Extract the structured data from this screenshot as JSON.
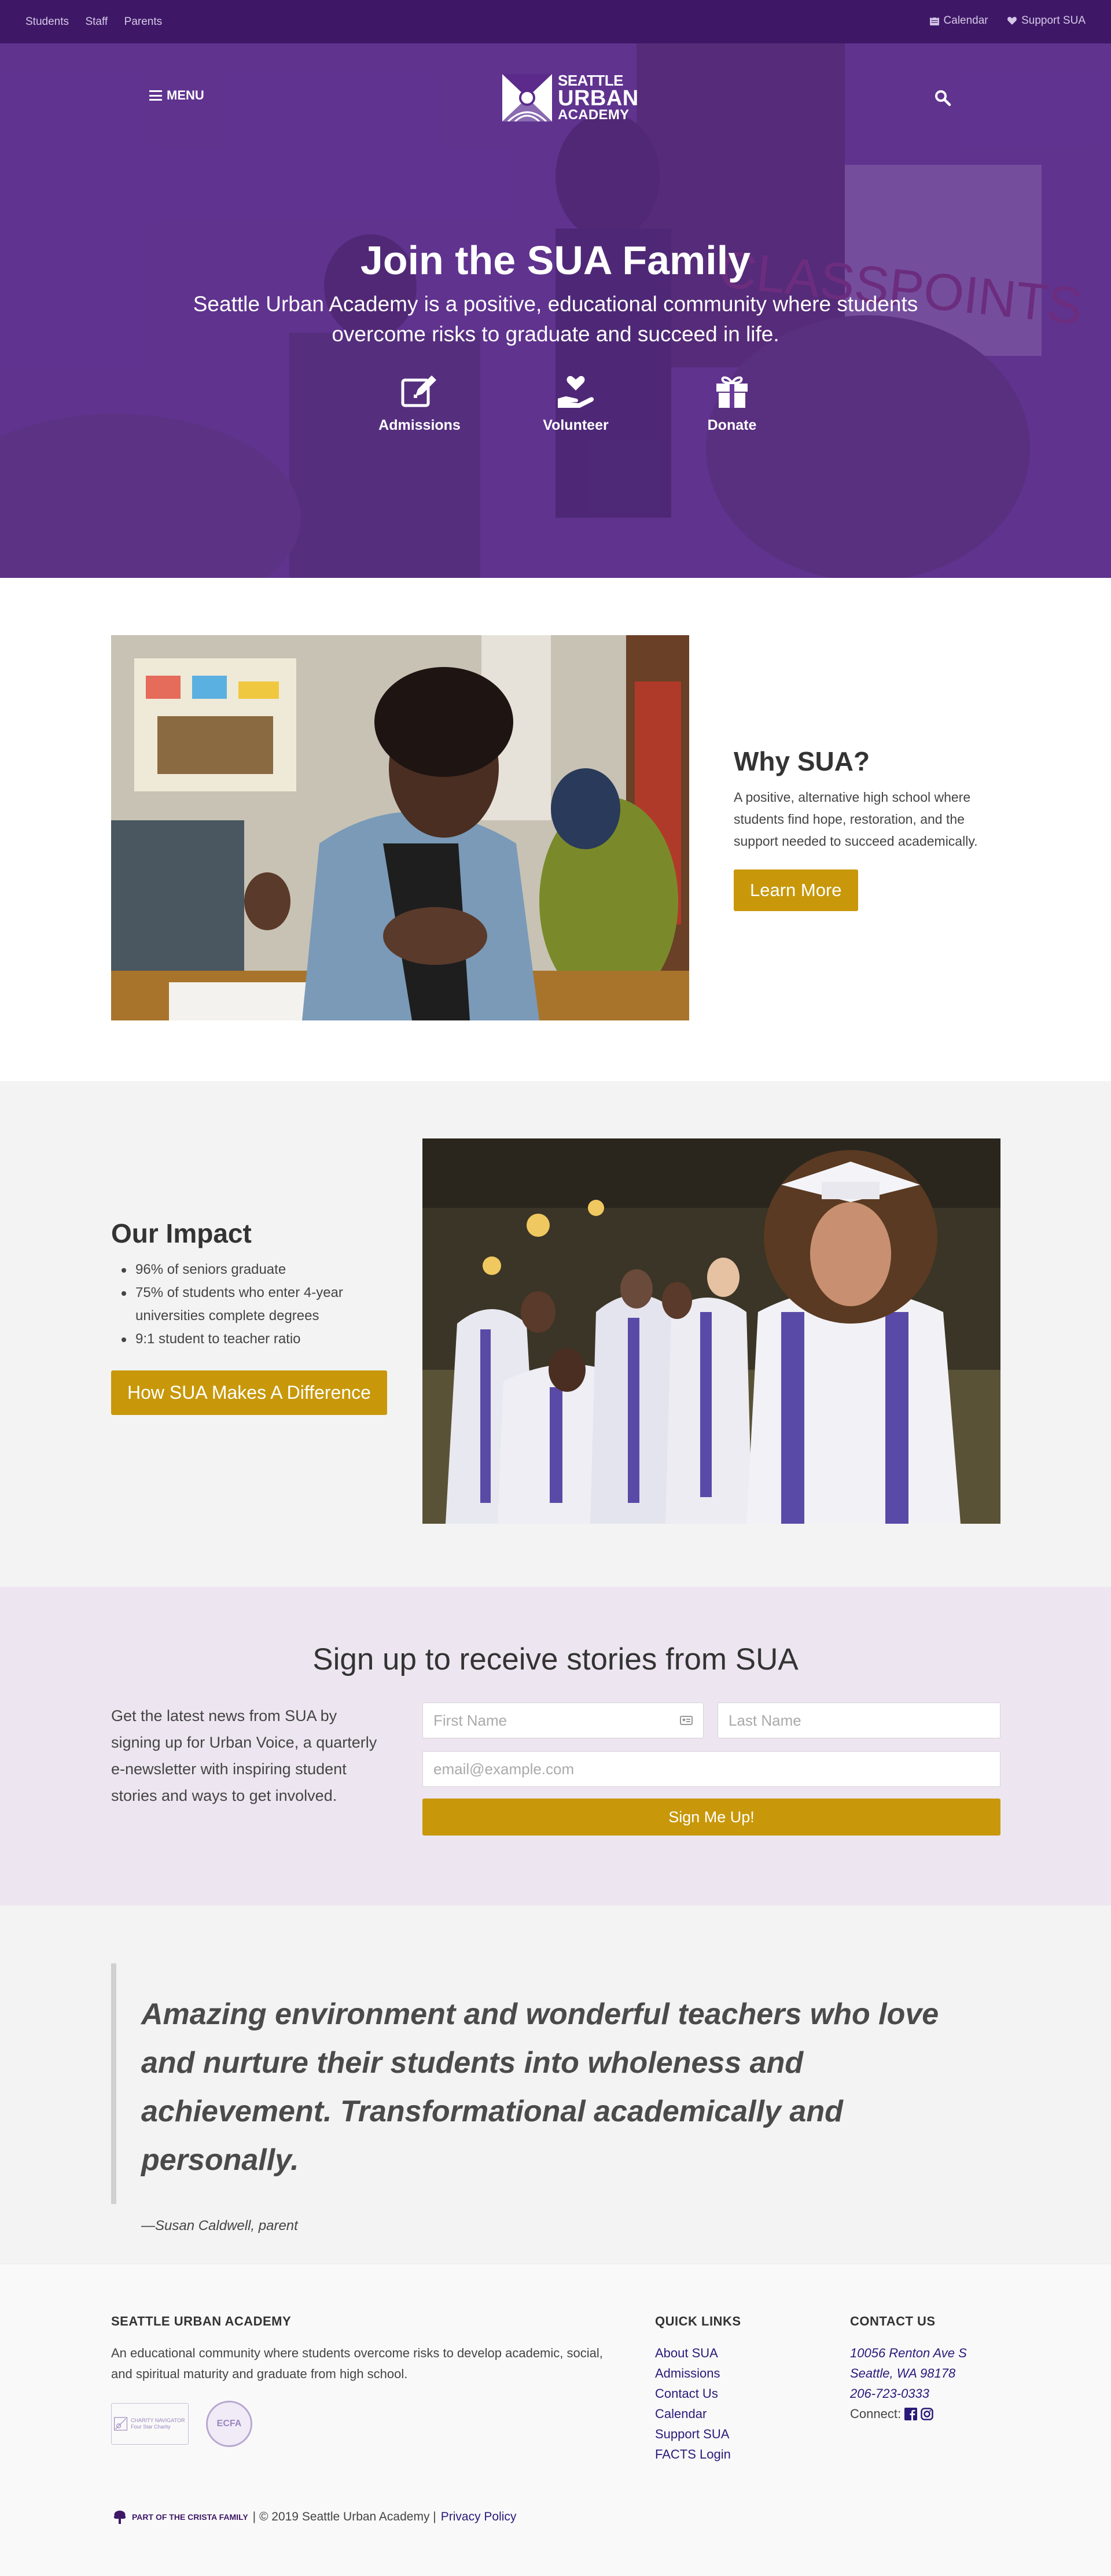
{
  "topbar": {
    "left_links": [
      "Students",
      "Staff",
      "Parents"
    ],
    "calendar": "Calendar",
    "support": "Support SUA"
  },
  "header": {
    "menu_label": "MENU",
    "logo": {
      "line1": "SEATTLE",
      "line2": "URBAN",
      "line3": "ACADEMY"
    }
  },
  "hero": {
    "title": "Join the SUA Family",
    "tagline": "Seattle Urban Academy is a positive, educational community where students overcome risks to graduate and succeed in life.",
    "actions": [
      {
        "label": "Admissions",
        "icon": "edit-icon"
      },
      {
        "label": "Volunteer",
        "icon": "hand-heart-icon"
      },
      {
        "label": "Donate",
        "icon": "gift-icon"
      }
    ],
    "overlay_color": "#5b2a8a"
  },
  "why": {
    "title": "Why SUA?",
    "body": "A positive, alternative high school where students find hope, restoration, and the support needed to succeed academically.",
    "button": "Learn More"
  },
  "impact": {
    "title": "Our Impact",
    "items": [
      "96% of seniors graduate",
      "75% of students who enter 4-year universities complete degrees",
      "9:1 student to teacher ratio"
    ],
    "button": "How SUA Makes A Difference"
  },
  "signup": {
    "title": "Sign up to receive stories from SUA",
    "intro": "Get the latest news from SUA by signing up for Urban Voice, a quarterly e-newsletter with inspiring student stories and ways to get involved.",
    "first_name_placeholder": "First Name",
    "last_name_placeholder": "Last Name",
    "email_placeholder": "email@example.com",
    "submit": "Sign Me Up!"
  },
  "testimonial": {
    "quote": "Amazing environment and wonderful teachers who love and nurture their students into wholeness and achievement. Transformational academically and personally.",
    "attribution": "—Susan Caldwell, parent"
  },
  "footer": {
    "about_title": "SEATTLE URBAN ACADEMY",
    "about_text": "An educational community where students overcome risks to develop academic, social, and spiritual maturity and graduate from high school.",
    "badge1": "CHARITY NAVIGATOR Four Star Charity",
    "badge2": "ECFA",
    "quick_links_title": "QUICK LINKS",
    "quick_links": [
      "About SUA",
      "Admissions",
      "Contact Us",
      "Calendar",
      "Support SUA",
      "FACTS Login"
    ],
    "contact_title": "CONTACT US",
    "address1": "10056 Renton Ave S",
    "address2": "Seattle, WA 98178",
    "phone": "206-723-0333",
    "connect": "Connect:",
    "crista": "PART OF THE CRISTA FAMILY",
    "copyright": "| © 2019 Seattle Urban Academy |",
    "privacy": "Privacy Policy"
  },
  "colors": {
    "brand_purple": "#3e1866",
    "hero_purple": "#5b2a8a",
    "gold": "#c8980a",
    "signup_bg": "#ede6f0"
  }
}
